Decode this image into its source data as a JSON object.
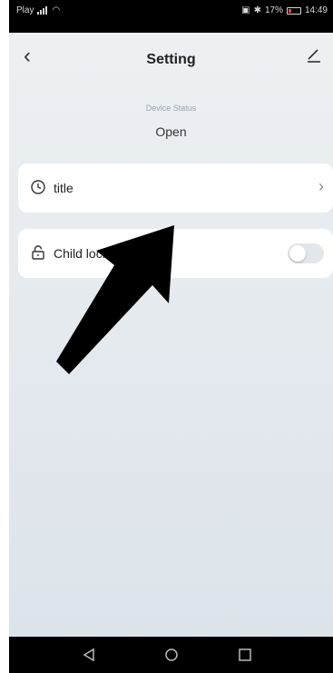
{
  "status_bar": {
    "carrier": "Play",
    "battery_pct": "17%",
    "time": "14:49"
  },
  "header": {
    "title": "Setting",
    "back_icon": "chevron-left-icon",
    "edit_icon": "pencil-icon"
  },
  "device": {
    "status_label": "Device Status",
    "status_value": "Open"
  },
  "items": [
    {
      "label": "title",
      "icon": "clock-icon",
      "trailing": "chevron-right-icon"
    },
    {
      "label": "Child lock",
      "icon": "lock-icon",
      "trailing": "toggle",
      "toggle_on": false
    }
  ],
  "overlay": {
    "icon": "arrow-up-right-icon",
    "color": "#000000"
  },
  "nav_bar": {
    "buttons": [
      "back-triangle-icon",
      "home-circle-icon",
      "recents-square-icon"
    ]
  }
}
